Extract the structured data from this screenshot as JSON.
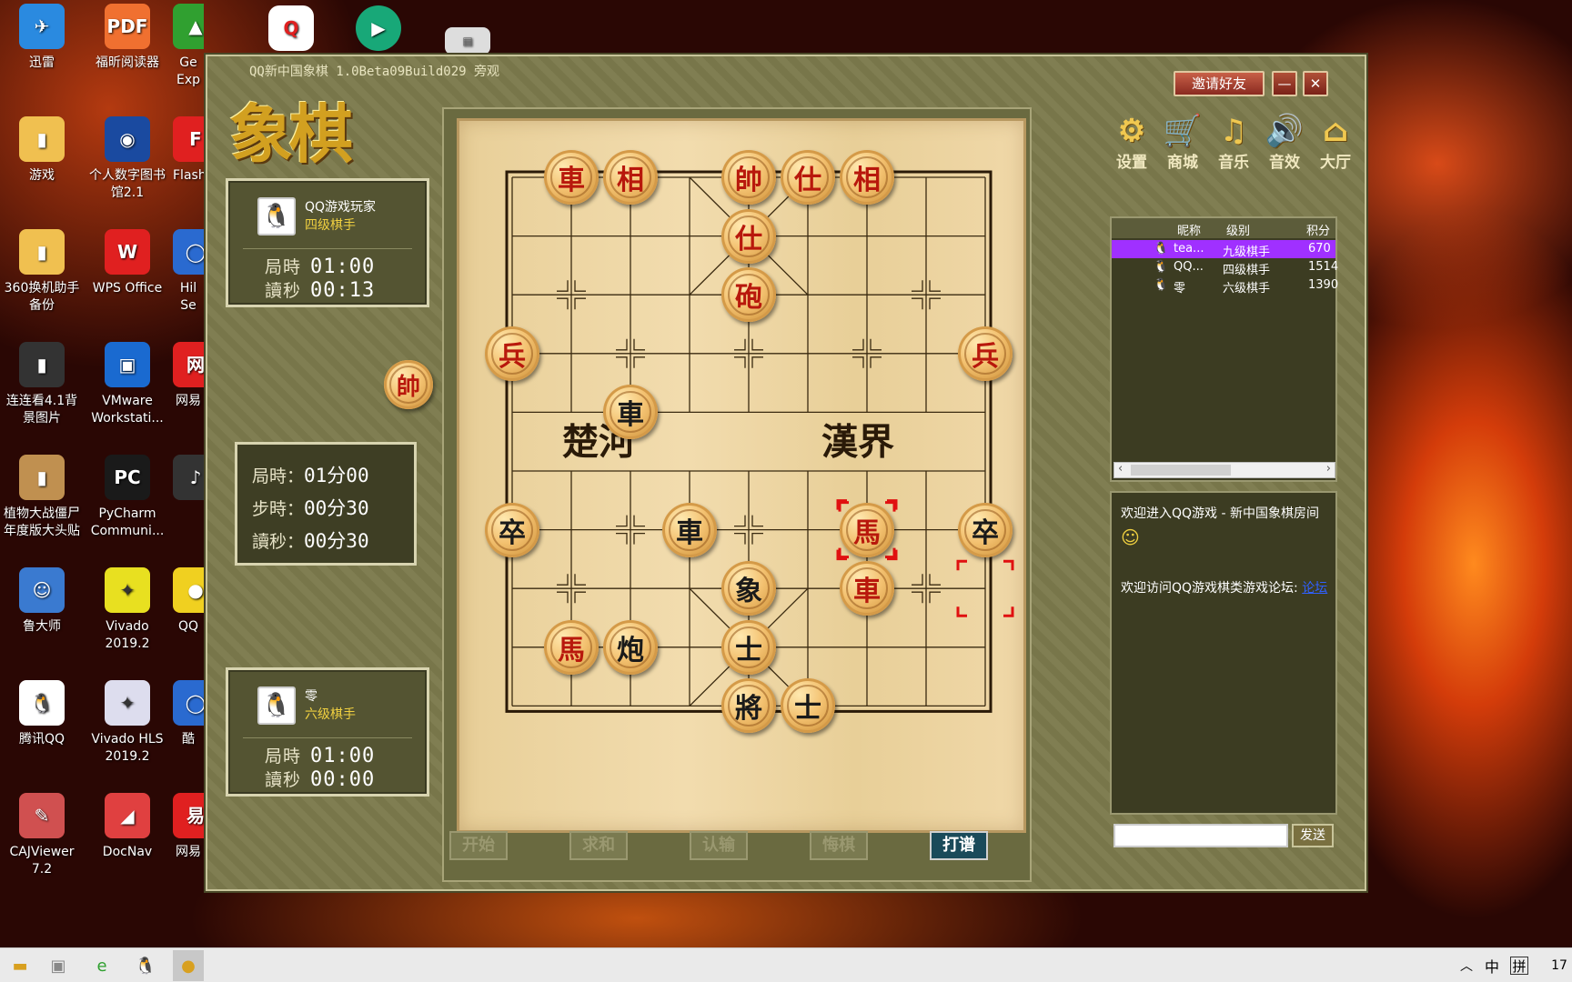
{
  "desktop": {
    "col1": [
      "迅雷",
      "游戏",
      "360换机助手\n备份",
      "连连看4.1背\n景图片",
      "植物大战僵尸\n年度版大头贴",
      "鲁大师",
      "腾讯QQ",
      "CAJViewer\n7.2"
    ],
    "col2": [
      "福昕阅读器",
      "个人数字图书\n馆2.1",
      "WPS Office",
      "VMware\nWorkstati...",
      "PyCharm\nCommuni...",
      "Vivado\n2019.2",
      "Vivado HLS\n2019.2",
      "DocNav"
    ],
    "col3": [
      "Ge\nExp",
      "Flash",
      "Hil\nSe",
      "网易",
      "",
      "QQ",
      "酷",
      "网易"
    ]
  },
  "window": {
    "title": "QQ新中国象棋 1.0Beta09Build029 旁观",
    "invite_button": "邀请好友",
    "minimize": "—",
    "close": "✕",
    "logo": "象棋"
  },
  "top_player": {
    "name": "QQ游戏玩家",
    "rank": "四级棋手",
    "time_label": "局時",
    "time": "01:00",
    "sec_label": "讀秒",
    "sec": "00:13",
    "icon": "qq-penguin-icon"
  },
  "turn_indicator": "帥",
  "time_settings": {
    "game_label": "局時：",
    "game": "01分00",
    "step_label": "步時：",
    "step": "00分30",
    "read_label": "讀秒：",
    "read": "00分30"
  },
  "bottom_player": {
    "name": "零",
    "rank": "六级棋手",
    "time_label": "局時",
    "time": "01:00",
    "sec_label": "讀秒",
    "sec": "00:00",
    "icon": "qq-penguin-icon"
  },
  "board": {
    "river_left": "楚河",
    "river_right": "漢界",
    "pieces": [
      {
        "ch": "車",
        "side": "red",
        "file": 1,
        "rank": 0
      },
      {
        "ch": "相",
        "side": "red",
        "file": 2,
        "rank": 0
      },
      {
        "ch": "帥",
        "side": "red",
        "file": 4,
        "rank": 0
      },
      {
        "ch": "仕",
        "side": "red",
        "file": 5,
        "rank": 0
      },
      {
        "ch": "相",
        "side": "red",
        "file": 6,
        "rank": 0
      },
      {
        "ch": "仕",
        "side": "red",
        "file": 4,
        "rank": 1
      },
      {
        "ch": "砲",
        "side": "red",
        "file": 4,
        "rank": 2
      },
      {
        "ch": "兵",
        "side": "red",
        "file": 0,
        "rank": 3
      },
      {
        "ch": "兵",
        "side": "red",
        "file": 8,
        "rank": 3
      },
      {
        "ch": "車",
        "side": "black",
        "file": 2,
        "rank": 4
      },
      {
        "ch": "卒",
        "side": "black",
        "file": 0,
        "rank": 6
      },
      {
        "ch": "車",
        "side": "black",
        "file": 3,
        "rank": 6
      },
      {
        "ch": "馬",
        "side": "red",
        "file": 6,
        "rank": 6
      },
      {
        "ch": "卒",
        "side": "black",
        "file": 8,
        "rank": 6
      },
      {
        "ch": "象",
        "side": "black",
        "file": 4,
        "rank": 7
      },
      {
        "ch": "車",
        "side": "red",
        "file": 6,
        "rank": 7
      },
      {
        "ch": "馬",
        "side": "red",
        "file": 1,
        "rank": 8
      },
      {
        "ch": "炮",
        "side": "black",
        "file": 2,
        "rank": 8
      },
      {
        "ch": "士",
        "side": "black",
        "file": 4,
        "rank": 8
      },
      {
        "ch": "將",
        "side": "black",
        "file": 4,
        "rank": 9
      },
      {
        "ch": "士",
        "side": "black",
        "file": 5,
        "rank": 9
      }
    ],
    "last_move_from": {
      "file": 8,
      "rank": 7
    },
    "last_move_to": {
      "file": 6,
      "rank": 6
    }
  },
  "controls": [
    "开始",
    "求和",
    "认输",
    "悔棋",
    "打谱"
  ],
  "toolbar": [
    {
      "label": "设置",
      "icon": "gear-icon",
      "glyph": "⚙"
    },
    {
      "label": "商城",
      "icon": "cart-icon",
      "glyph": "🛒"
    },
    {
      "label": "音乐",
      "icon": "music-icon",
      "glyph": "♫"
    },
    {
      "label": "音效",
      "icon": "speaker-icon",
      "glyph": "🔊"
    },
    {
      "label": "大厅",
      "icon": "home-icon",
      "glyph": "⌂"
    }
  ],
  "player_list": {
    "headers": [
      "昵称",
      "级别",
      "积分"
    ],
    "rows": [
      {
        "nick": "tea...",
        "rank": "九级棋手",
        "score": "670",
        "selected": true
      },
      {
        "nick": "QQ...",
        "rank": "四级棋手",
        "score": "1514",
        "selected": false
      },
      {
        "nick": "零",
        "rank": "六级棋手",
        "score": "1390",
        "selected": false
      }
    ]
  },
  "chat": {
    "line1": "欢迎进入QQ游戏 - 新中国象棋房间",
    "line2": "欢迎访问QQ游戏棋类游戏论坛:",
    "link": "论坛",
    "send": "发送",
    "input": ""
  },
  "taskbar": {
    "tray_ime": "中",
    "tray_layout": "拼",
    "clock": "17"
  },
  "colors": {
    "accent_red": "#b8180c",
    "board": "#f0d8a8",
    "window": "#7c7a4c",
    "selected_row": "#a030ff"
  }
}
